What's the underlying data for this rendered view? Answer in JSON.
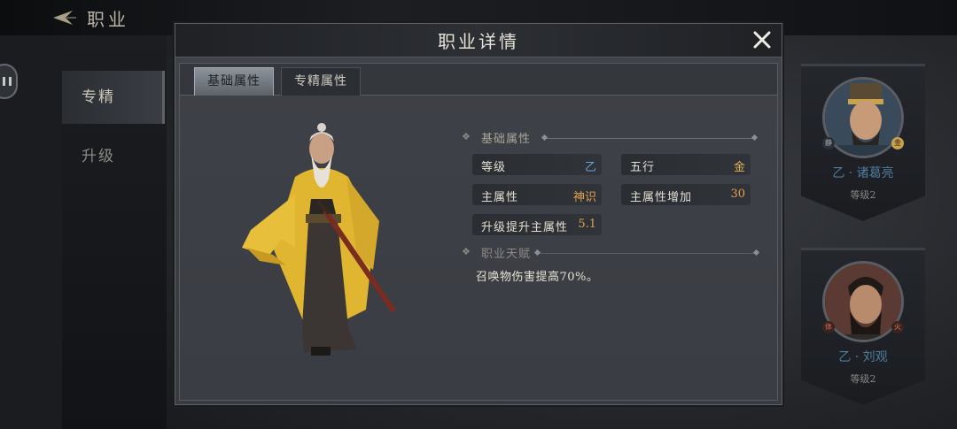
{
  "header": {
    "title": "职业",
    "back_icon": "back-arrow-icon"
  },
  "side_nav": {
    "items": [
      {
        "label": "专精",
        "active": true
      },
      {
        "label": "升级",
        "active": false
      }
    ]
  },
  "cards": [
    {
      "name": "乙 · 诸葛亮",
      "level": "等级2",
      "badges": [
        "静",
        "金"
      ]
    },
    {
      "name": "乙 · 刘观",
      "level": "等级2",
      "badges": [
        "体",
        "火"
      ]
    }
  ],
  "modal": {
    "title": "职业详情",
    "close_icon": "close-icon",
    "tabs": [
      {
        "label": "基础属性",
        "active": true
      },
      {
        "label": "专精属性",
        "active": false
      }
    ],
    "basic_section": {
      "heading": "基础属性",
      "rows": [
        {
          "key": "等级",
          "value": "乙",
          "color": "#6aa3d8"
        },
        {
          "key": "五行",
          "value": "金",
          "color": "#e3b45c"
        },
        {
          "key": "主属性",
          "value": "神识",
          "color": "#e0a24f"
        },
        {
          "key": "主属性增加",
          "value": "30",
          "color": "#e0a24f"
        },
        {
          "key": "升级提升主属性",
          "value": "5.1",
          "color": "#e0a24f"
        }
      ]
    },
    "talent_section": {
      "heading": "职业天赋",
      "text": "召唤物伤害提高70%。"
    }
  },
  "colors": {
    "accent_gold": "#e3b45c",
    "accent_blue": "#6aa3d8",
    "panel_bg": "#3b3e44"
  }
}
